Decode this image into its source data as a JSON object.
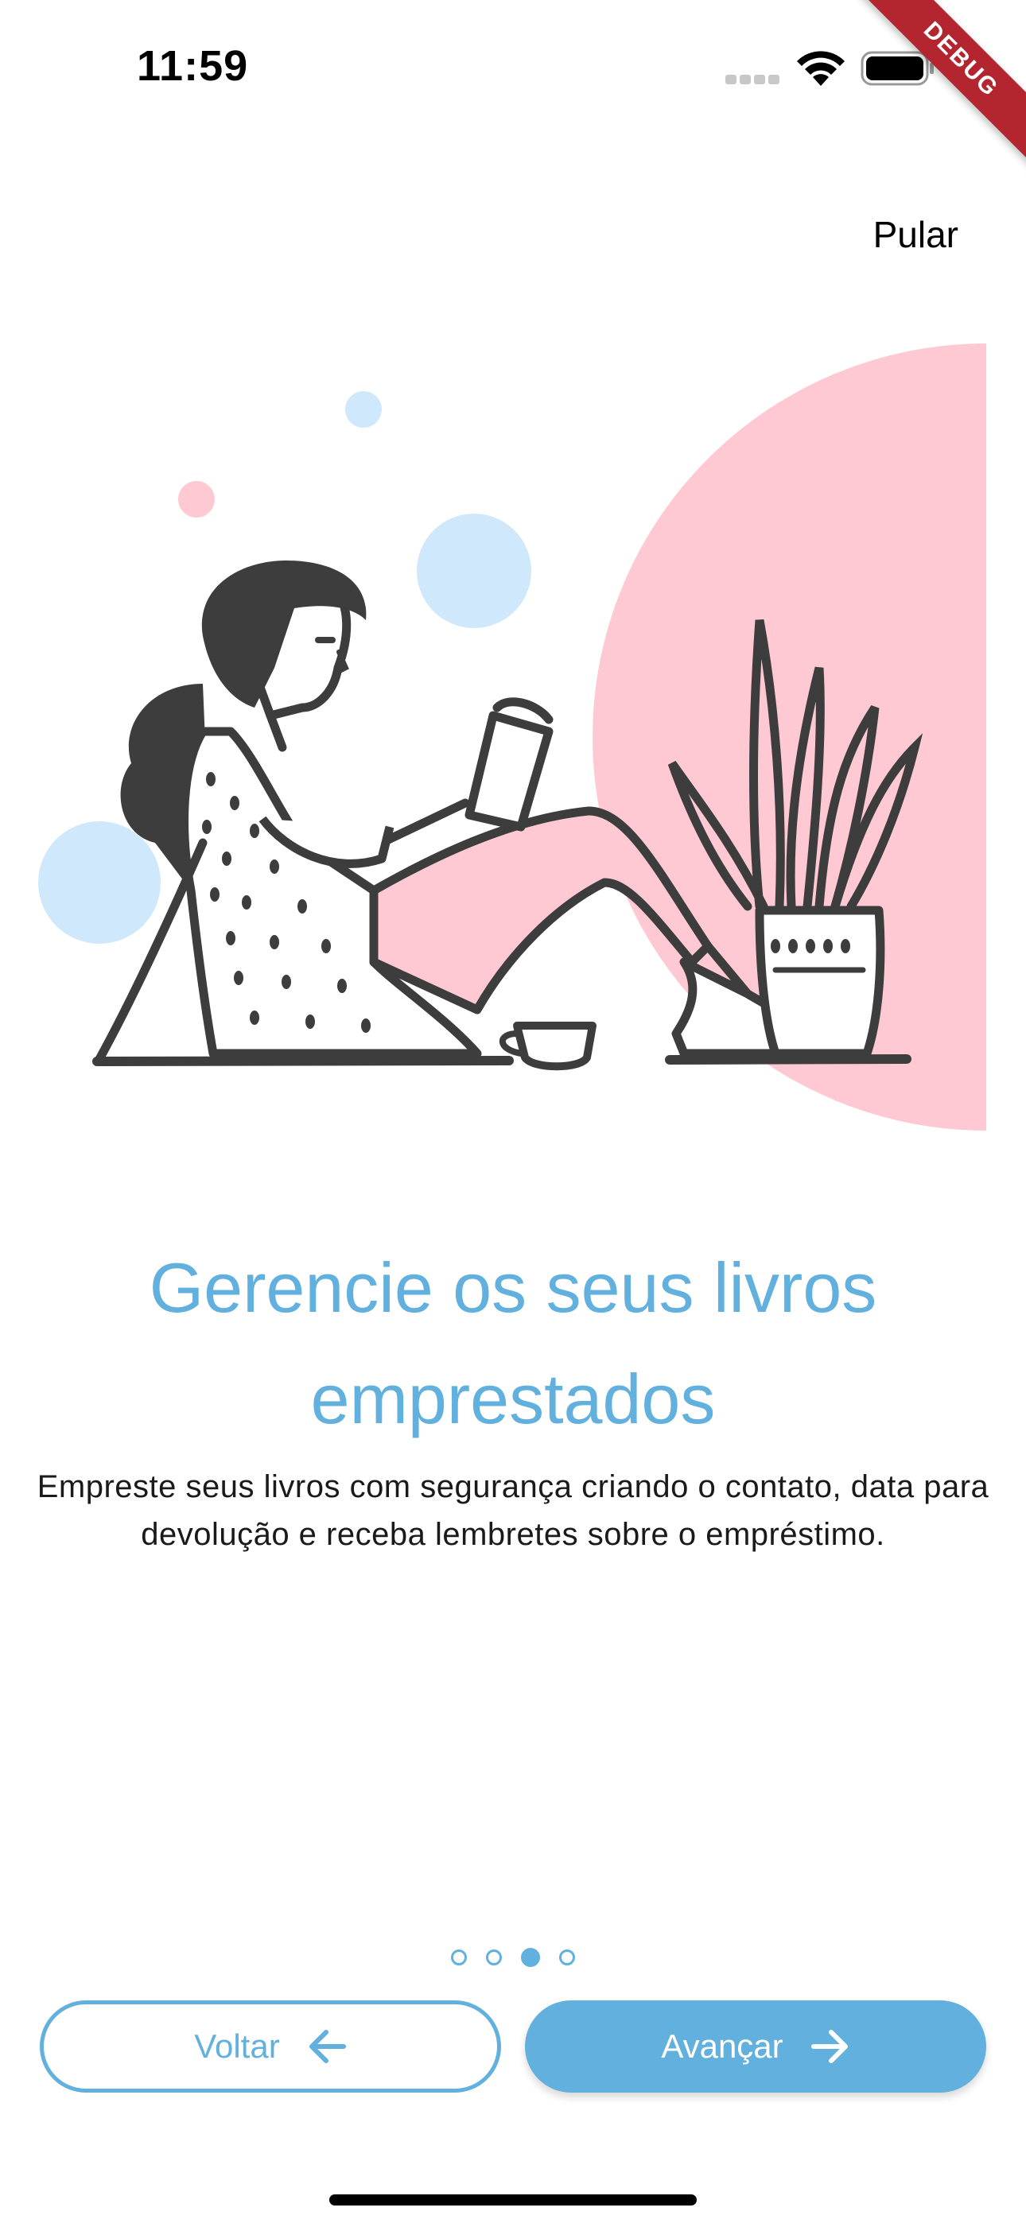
{
  "status_bar": {
    "time": "11:59",
    "icons": [
      "signal-icon",
      "wifi-icon",
      "battery-icon"
    ]
  },
  "debug_banner": "DEBUG",
  "header": {
    "skip_label": "Pular"
  },
  "onboarding": {
    "title": "Gerencie os seus livros emprestados",
    "description": "Empreste seus livros com segurança criando o contato, data para devolução e receba lembretes sobre o empréstimo.",
    "page_count": 4,
    "current_page": 3
  },
  "footer": {
    "back_label": "Voltar",
    "next_label": "Avançar"
  },
  "colors": {
    "accent": "#62b0dd",
    "pink": "#ffc9d4",
    "light_blue": "#cfe8fb",
    "ink": "#3d3d3d"
  }
}
